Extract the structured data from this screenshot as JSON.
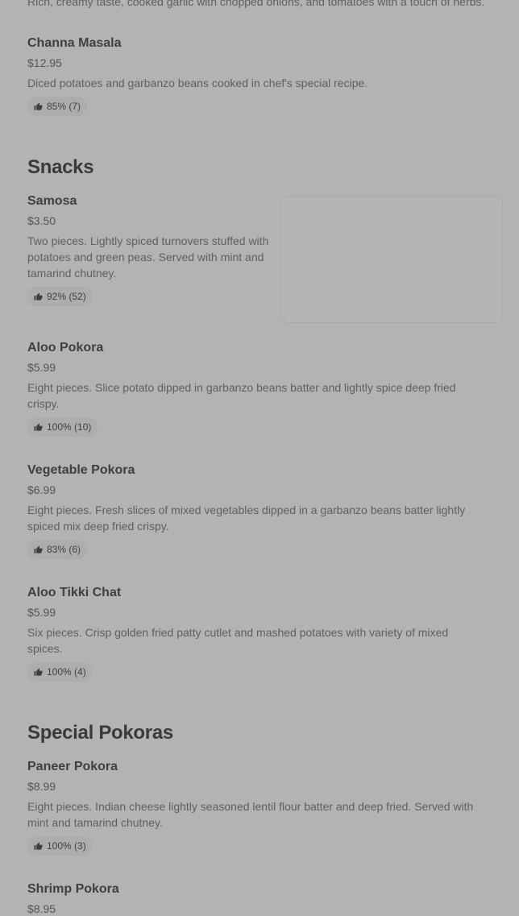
{
  "top_text": "Rich, creamy taste, cooked garlic with chopped onions, and tomatoes with a touch of herbs.",
  "sections": [
    {
      "title": "Snacks"
    },
    {
      "title": "Special Pokoras"
    }
  ],
  "items": [
    {
      "name": "Channa Masala",
      "price": "$12.95",
      "description": "Diced potatoes and garbanzo beans cooked in chef's special recipe.",
      "rating": "85% (7)"
    },
    {
      "name": "Samosa",
      "price": "$3.50",
      "description": "Two pieces. Lightly spiced turnovers stuffed with potatoes and green peas. Served with mint and tamarind chutney.",
      "rating": "92% (52)"
    },
    {
      "name": "Aloo Pokora",
      "price": "$5.99",
      "description": "Eight pieces. Slice potato dipped in garbanzo beans batter and lightly spice deep fried crispy.",
      "rating": "100% (10)"
    },
    {
      "name": "Vegetable Pokora",
      "price": "$6.99",
      "description": "Eight pieces. Fresh slices of mixed vegetables dipped in a garbanzo beans batter lightly spiced mix deep fried crispy.",
      "rating": "83% (6)"
    },
    {
      "name": "Aloo Tikki Chat",
      "price": "$5.99",
      "description": "Six pieces. Crisp golden fried patty cutlet and mashed potatoes with variety of mixed spices.",
      "rating": "100% (4)"
    },
    {
      "name": "Paneer Pokora",
      "price": "$8.99",
      "description": "Eight pieces. Indian cheese lightly seasoned lentil flour batter and deep fried. Served with mint and tamarind chutney.",
      "rating": "100% (3)"
    },
    {
      "name": "Shrimp Pokora",
      "price": "$8.95",
      "description": "",
      "rating": ""
    }
  ],
  "icons": {
    "rating_icon": "thumbs-up-icon"
  }
}
